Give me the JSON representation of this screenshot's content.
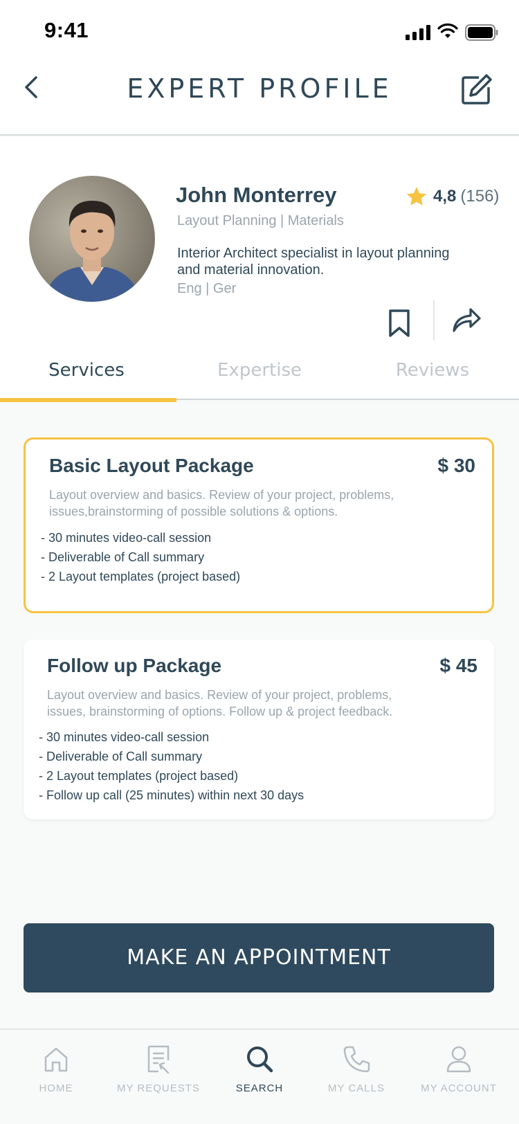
{
  "status_bar": {
    "time": "9:41"
  },
  "header": {
    "title": "EXPERT PROFILE",
    "back_icon": "chevron-left-icon",
    "edit_icon": "edit-icon"
  },
  "expert": {
    "name": "John Monterrey",
    "rating": "4,8",
    "reviews_count": "(156)",
    "specialty": "Layout Planning | Materials",
    "bio": "Interior Architect specialist in layout planning and material innovation.",
    "languages": "Eng | Ger"
  },
  "tabs": [
    {
      "label": "Services",
      "active": true
    },
    {
      "label": "Expertise",
      "active": false
    },
    {
      "label": "Reviews",
      "active": false
    }
  ],
  "packages": [
    {
      "name": "Basic Layout Package",
      "price": "$ 30",
      "description": "Layout overview and basics. Review of your project, problems, issues,brainstorming of possible solutions & options.",
      "features": [
        "- 30 minutes video-call session",
        "- Deliverable of Call summary",
        "- 2 Layout templates (project based)"
      ],
      "selected": true
    },
    {
      "name": "Follow up Package",
      "price": "$ 45",
      "description": "Layout overview and basics. Review of your project, problems, issues, brainstorming of options. Follow up & project feedback.",
      "features": [
        "- 30 minutes video-call session",
        "- Deliverable of Call summary",
        "- 2 Layout templates (project based)",
        "- Follow up call (25 minutes) within next 30 days"
      ],
      "selected": false
    }
  ],
  "cta": {
    "label": "MAKE AN APPOINTMENT"
  },
  "bottom_nav": [
    {
      "label": "HOME",
      "icon": "home-icon",
      "active": false
    },
    {
      "label": "MY REQUESTS",
      "icon": "requests-icon",
      "active": false
    },
    {
      "label": "SEARCH",
      "icon": "search-icon",
      "active": true
    },
    {
      "label": "MY CALLS",
      "icon": "phone-icon",
      "active": false
    },
    {
      "label": "MY ACCOUNT",
      "icon": "user-icon",
      "active": false
    }
  ],
  "colors": {
    "accent": "#f6c343",
    "primary": "#2f4a5e",
    "muted": "#9aa5ac"
  }
}
